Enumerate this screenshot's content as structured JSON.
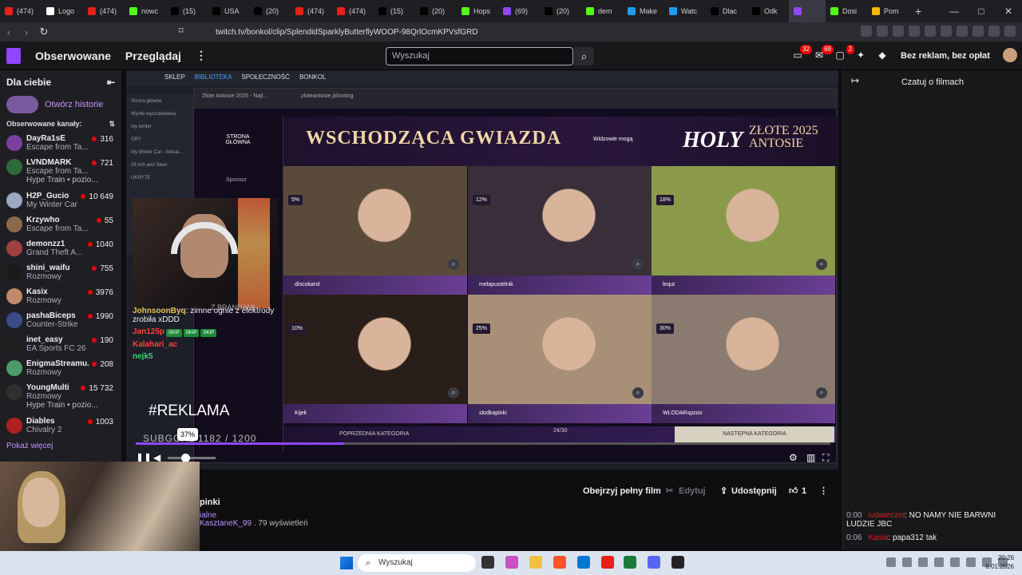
{
  "browser": {
    "tabs": [
      {
        "label": "(474)",
        "color": "#e62117"
      },
      {
        "label": "Logo",
        "color": "#ffffff"
      },
      {
        "label": "(474)",
        "color": "#e62117"
      },
      {
        "label": "nowc",
        "color": "#53fc18"
      },
      {
        "label": "(15)",
        "color": "#000000"
      },
      {
        "label": "USA",
        "color": "#000000"
      },
      {
        "label": "(20)",
        "color": "#000000"
      },
      {
        "label": "(474)",
        "color": "#e62117"
      },
      {
        "label": "(474)",
        "color": "#e62117"
      },
      {
        "label": "(15)",
        "color": "#000000"
      },
      {
        "label": "(20)",
        "color": "#000000"
      },
      {
        "label": "Hops",
        "color": "#53fc18"
      },
      {
        "label": "(69)",
        "color": "#9146ff"
      },
      {
        "label": "(20)",
        "color": "#000000"
      },
      {
        "label": "dem",
        "color": "#53fc18"
      },
      {
        "label": "Make",
        "color": "#1d9bf0"
      },
      {
        "label": "Watc",
        "color": "#1d9bf0"
      },
      {
        "label": "Dlac",
        "color": "#000000"
      },
      {
        "label": "Odk",
        "color": "#000000"
      },
      {
        "label": "",
        "color": "#9146ff"
      },
      {
        "label": "Dosi",
        "color": "#53fc18"
      },
      {
        "label": "Pom",
        "color": "#f5b800"
      }
    ],
    "new_tab": "+",
    "url": "twitch.tv/bonkol/clip/SplendidSparklyButterflyWOOP-98QrlOcmKPVsfGRD"
  },
  "twitch_nav": {
    "following": "Obserwowane",
    "browse": "Przeglądaj",
    "more": "⋮",
    "search_placeholder": "Wyszukaj",
    "badge_inbox": "32",
    "badge_whispers": "69",
    "badge_notifications": "2",
    "adfree": "Bez reklam, bez opłat"
  },
  "sidebar": {
    "title": "Dla ciebie",
    "stories": "Otwórz historie",
    "followed_label": "Obserwowane kanały:",
    "channels": [
      {
        "name": "DayRa1sE",
        "game": "Escape from Ta...",
        "viewers": "316",
        "color": "#7b3fa0"
      },
      {
        "name": "LVNDMARK",
        "game": "Escape from Ta...",
        "viewers": "721",
        "color": "#2f6a3a",
        "hype": "Hype Train • pozio..."
      },
      {
        "name": "H2P_Gucio",
        "game": "My Winter Car",
        "viewers": "10 649",
        "color": "#9aa8c0"
      },
      {
        "name": "Krzywho",
        "game": "Escape from Ta...",
        "viewers": "55",
        "color": "#8a6a4a"
      },
      {
        "name": "demonzz1",
        "game": "Grand Theft A...",
        "viewers": "1040",
        "color": "#a04040"
      },
      {
        "name": "shini_waifu",
        "game": "Rozmowy",
        "viewers": "755",
        "color": "#1a1a1a"
      },
      {
        "name": "Kasix",
        "game": "Rozmowy",
        "viewers": "3976",
        "color": "#c08a6a"
      },
      {
        "name": "pashaBiceps",
        "game": "Counter-Strike",
        "viewers": "1990",
        "color": "#3a4a8a"
      },
      {
        "name": "inet_easy",
        "game": "EA Sports FC 26",
        "viewers": "190",
        "color": "#202020"
      },
      {
        "name": "EnigmaStreamu...",
        "game": "Rozmowy",
        "viewers": "208",
        "color": "#4a9a6a"
      },
      {
        "name": "YoungMulti",
        "game": "Rozmowy",
        "viewers": "15 732",
        "color": "#303030",
        "hype": "Hype Train • pozio..."
      },
      {
        "name": "Diables",
        "game": "Chivalry 2",
        "viewers": "1003",
        "color": "#b02020"
      }
    ],
    "show_more": "Pokaż więcej"
  },
  "video": {
    "inner_tabs": {
      "shop": "SKLEP",
      "library": "BIBLIOTEKA",
      "community": "SPOŁECZNOŚĆ",
      "user": "BONKOL"
    },
    "inner_left": [
      "Strona główna",
      "Wyniki wyszukiwania",
      "my winter",
      "GRY",
      "My Winter Car - Aktual...",
      "Of Ash and Steel",
      "UKRYTE"
    ],
    "site_tab": "Złote Antosie 2025 - Najl...",
    "site_url": "zloteantosie.pl/voting",
    "site_home": "STRONA GŁÓWNA",
    "sponsor": "Sponsor",
    "title": "WSCHODZĄCA GWIAZDA",
    "viewers_can": "Widzowie mogą",
    "brand1": "HOLY",
    "brand2_line1": "ZŁOTE 2025",
    "brand2_line2": "ANTOSIE",
    "cards": [
      {
        "name": "discokarol",
        "pct": "5%",
        "bg": "#5a4a3a"
      },
      {
        "name": "melapustelnik",
        "pct": "12%",
        "bg": "#3a2e3a"
      },
      {
        "name": "lequt",
        "pct": "18%",
        "bg": "#8a9a4a"
      },
      {
        "name": "Kijek",
        "pct": "10%",
        "bg": "#2a1e1a"
      },
      {
        "name": "slodkapinki",
        "pct": "25%",
        "bg": "#a89078"
      },
      {
        "name": "WLODARspzoo",
        "pct": "30%",
        "bg": "#8a7a70"
      }
    ],
    "prev_category": "POPRZEDNIA KATEGORIA",
    "page_count": "24/30",
    "next_category": "NASTĘPNA KATEGORIA",
    "chat_overlay": [
      {
        "user": "JohnsoonByq",
        "text": ": zimne ognie z elektrody zrobiła xDDD"
      },
      {
        "user": "Jan125p",
        "text": ""
      },
      {
        "user": "Kalahari_ac",
        "text": ""
      },
      {
        "user": "nejk5",
        "text": ""
      }
    ],
    "skip_label": "SKIP",
    "streamer_label": "Z BRANDAMI",
    "reklama": "#REKLAMA",
    "subgoal": "SUBGOAL 1182 / 1200",
    "volume_tip": "37%",
    "progress": 0.3,
    "volume": 0.37
  },
  "below_video": {
    "watch_full": "Obejrzyj pełny film",
    "edit": "Edytuj",
    "share": "Udostępnij",
    "likes": "1",
    "clip_title": "pinki",
    "clip_category": "ialne",
    "clip_author": "KasztaneK_99",
    "clip_views": ". 79 wyświetleń"
  },
  "right_panel": {
    "title": "Czatuj o filmach",
    "chat": [
      {
        "time": "0:00",
        "user": "ivdwieczel",
        "text": ": NO NAMY NIE BARWNI LUDZIE JBC"
      },
      {
        "time": "0:06",
        "user": "Kasia",
        "text": ": papa312 tak"
      }
    ]
  },
  "taskbar": {
    "search": "Wyszukaj",
    "time": "20:26",
    "date": "6.01.2026"
  }
}
